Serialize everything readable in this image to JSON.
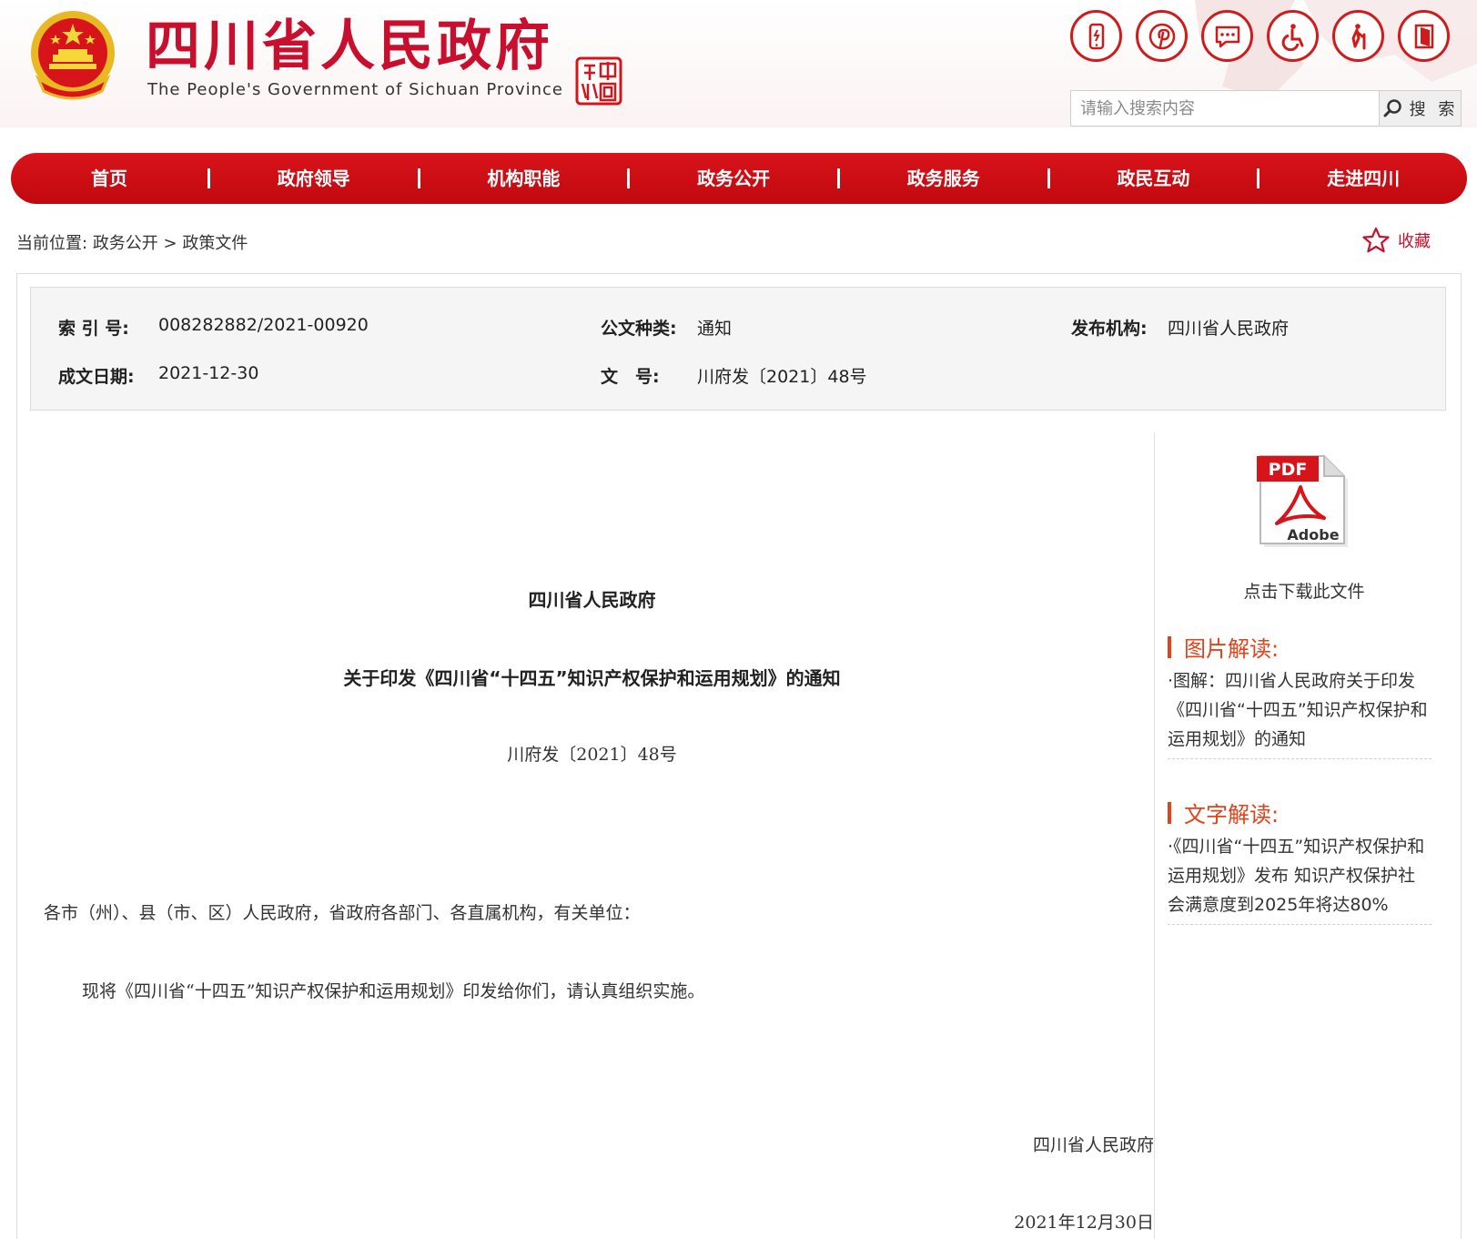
{
  "header": {
    "site_title": "四川省人民政府",
    "site_subtitle": "The People's Government of Sichuan Province",
    "seal_text": "中國四川",
    "icons": [
      "mobile-icon",
      "pinterest-icon",
      "message-icon",
      "accessibility-icon",
      "elderly-icon",
      "exit-icon"
    ],
    "search": {
      "placeholder": "请输入搜索内容",
      "button_label": "搜 索"
    }
  },
  "nav": {
    "items": [
      "首页",
      "政府领导",
      "机构职能",
      "政务公开",
      "政务服务",
      "政民互动",
      "走进四川"
    ]
  },
  "breadcrumb": {
    "prefix": "当前位置:",
    "items": [
      "政务公开",
      "政策文件"
    ],
    "separator": ">",
    "favorite_label": "收藏"
  },
  "meta": {
    "index_label": "索 引 号:",
    "index_value": "008282882/2021-00920",
    "type_label": "公文种类:",
    "type_value": "通知",
    "issuer_label": "发布机构:",
    "issuer_value": "四川省人民政府",
    "date_label": "成文日期:",
    "date_value": "2021-12-30",
    "number_label": "文　号:",
    "number_value": "川府发〔2021〕48号"
  },
  "document": {
    "org": "四川省人民政府",
    "title": "关于印发《四川省“十四五”知识产权保护和运用规划》的通知",
    "number": "川府发〔2021〕48号",
    "addressee": "各市（州）、县（市、区）人民政府，省政府各部门、各直属机构，有关单位：",
    "body": "现将《四川省“十四五”知识产权保护和运用规划》印发给你们，请认真组织实施。",
    "signature": "四川省人民政府",
    "date": "2021年12月30日"
  },
  "sidebar": {
    "pdf_label": "PDF",
    "pdf_brand": "Adobe",
    "download_label": "点击下载此文件",
    "image_section_title": "图片解读:",
    "image_item": "·图解：四川省人民政府关于印发《四川省“十四五”知识产权保护和运用规划》的通知",
    "text_section_title": "文字解读:",
    "text_item": "·《四川省“十四五”知识产权保护和运用规划》发布 知识产权保护社会满意度到2025年将达80%"
  },
  "colors": {
    "brand_red": "#c8102e",
    "nav_red": "#d9131a",
    "accent_orange": "#e3431b"
  }
}
